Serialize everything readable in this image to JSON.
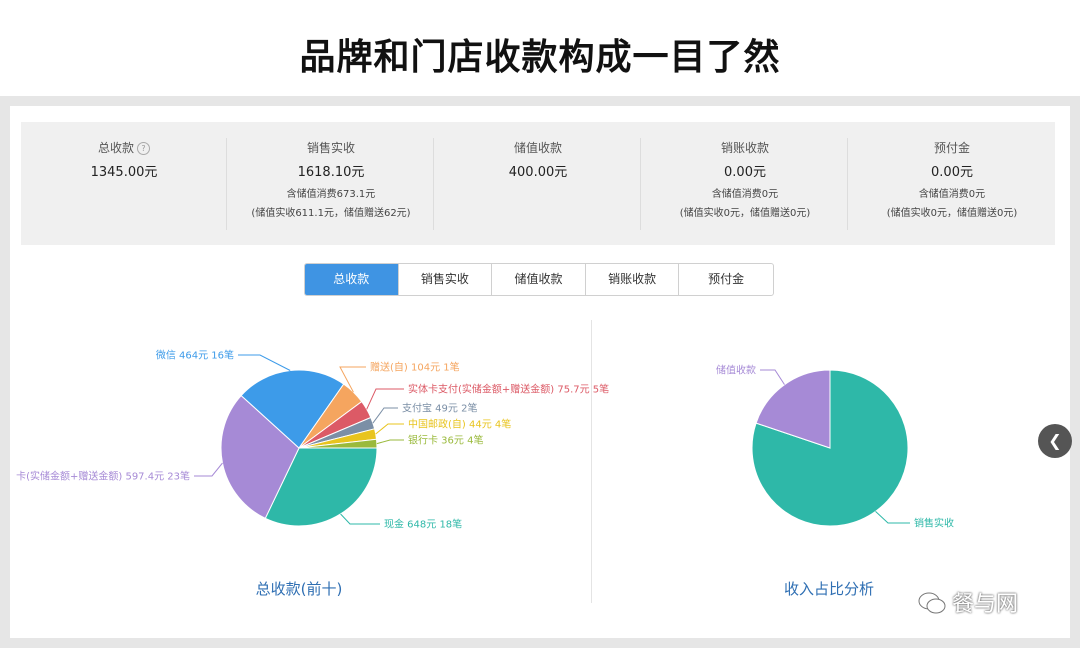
{
  "page": {
    "headline": "品牌和门店收款构成一目了然"
  },
  "summary": [
    {
      "label": "总收款",
      "value": "1345.00元",
      "sub1": "",
      "sub2": "",
      "help": "?"
    },
    {
      "label": "销售实收",
      "value": "1618.10元",
      "sub1": "含储值消费673.1元",
      "sub2": "(储值实收611.1元，储值赠送62元)"
    },
    {
      "label": "储值收款",
      "value": "400.00元",
      "sub1": "",
      "sub2": ""
    },
    {
      "label": "销账收款",
      "value": "0.00元",
      "sub1": "含储值消费0元",
      "sub2": "(储值实收0元，储值赠送0元)"
    },
    {
      "label": "预付金",
      "value": "0.00元",
      "sub1": "含储值消费0元",
      "sub2": "(储值实收0元，储值赠送0元)"
    }
  ],
  "tabs": [
    "总收款",
    "销售实收",
    "储值收款",
    "销账收款",
    "预付金"
  ],
  "active_tab": 0,
  "chart_data": [
    {
      "type": "pie",
      "title": "总收款(前十)",
      "slices": [
        {
          "label": "现金 648元 18笔",
          "value": 648,
          "color": "#2eb8a8"
        },
        {
          "label": "卡(实储金额+赠送金额) 597.4元 23笔",
          "value": 597.4,
          "color": "#a68ad6"
        },
        {
          "label": "微信 464元 16笔",
          "value": 464,
          "color": "#3d9be9"
        },
        {
          "label": "赠送(自) 104元 1笔",
          "value": 104,
          "color": "#f5a55f"
        },
        {
          "label": "实体卡支付(实储金额+赠送金额) 75.7元 5笔",
          "value": 75.7,
          "color": "#dc5a66"
        },
        {
          "label": "支付宝 49元 2笔",
          "value": 49,
          "color": "#7b8fa6"
        },
        {
          "label": "中国邮政(自) 44元 4笔",
          "value": 44,
          "color": "#e8c41e"
        },
        {
          "label": "银行卡 36元 4笔",
          "value": 36,
          "color": "#9aba3c"
        }
      ]
    },
    {
      "type": "pie",
      "title": "收入占比分析",
      "slices": [
        {
          "label": "销售实收",
          "value": 1618.1,
          "color": "#2eb8a8"
        },
        {
          "label": "储值收款",
          "value": 400,
          "color": "#a68ad6"
        }
      ]
    }
  ],
  "side_handle_icon": "chevron-left-icon",
  "watermark": {
    "text": "餐与网",
    "icon": "wechat-icon"
  }
}
